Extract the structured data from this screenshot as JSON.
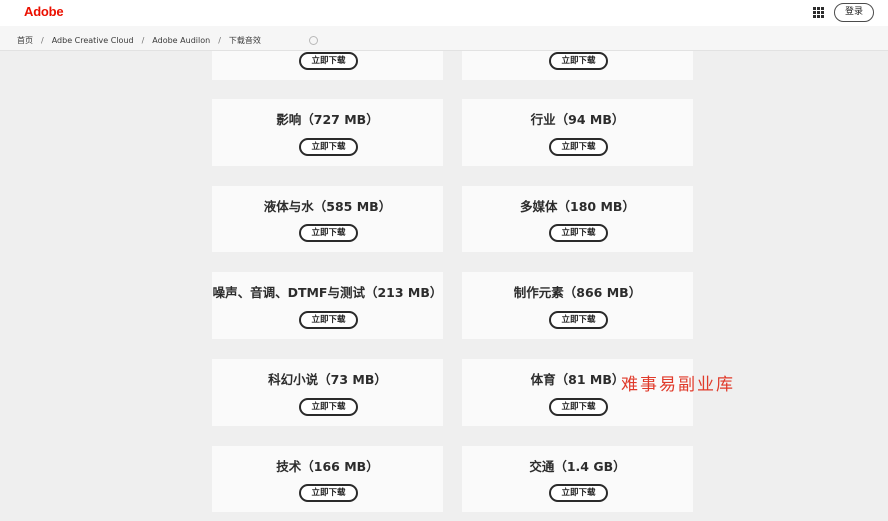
{
  "header": {
    "logo_text": "Adobe",
    "apps_icon": "app-grid-icon",
    "login_label": "登录"
  },
  "breadcrumb": [
    "首页",
    "Adbe Creative Cloud",
    "Adobe Audilon",
    "下载音效"
  ],
  "breadcrumb_separator": "/",
  "download_label": "立即下载",
  "cards_top_partial": [
    {
      "download": "立即下载"
    },
    {
      "download": "立即下载"
    }
  ],
  "cards": [
    {
      "title": "影响（727 MB）"
    },
    {
      "title": "行业（94 MB）"
    },
    {
      "title": "液体与水（585 MB）"
    },
    {
      "title": "多媒体（180 MB）"
    },
    {
      "title": "噪声、音调、DTMF与测试（213 MB）"
    },
    {
      "title": "制作元素（866 MB）"
    },
    {
      "title": "科幻小说（73 MB）"
    },
    {
      "title": "体育（81 MB）"
    },
    {
      "title": "技术（166 MB）"
    },
    {
      "title": "交通（1.4 GB）"
    }
  ],
  "watermark_text": "难事易副业库",
  "colors": {
    "brand": "#eb1000",
    "watermark": "#e03a2a",
    "page_bg": "#efefef",
    "card_bg": "#fafafa"
  }
}
